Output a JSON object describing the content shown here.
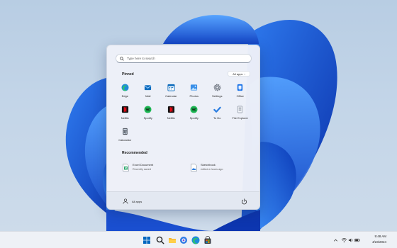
{
  "search": {
    "placeholder": "Type here to search"
  },
  "pinned": {
    "title": "Pinned",
    "all_apps_label": "All apps",
    "apps": [
      {
        "label": "Edge",
        "icon": "edge-icon"
      },
      {
        "label": "Mail",
        "icon": "mail-icon"
      },
      {
        "label": "Calendar",
        "icon": "calendar-icon"
      },
      {
        "label": "Photos",
        "icon": "photos-icon"
      },
      {
        "label": "Settings",
        "icon": "settings-icon"
      },
      {
        "label": "Office",
        "icon": "office-icon"
      },
      {
        "label": "Netflix",
        "icon": "netflix-icon"
      },
      {
        "label": "Spotify",
        "icon": "spotify-icon"
      },
      {
        "label": "Netflix",
        "icon": "netflix-icon"
      },
      {
        "label": "Spotify",
        "icon": "spotify-icon"
      },
      {
        "label": "To Do",
        "icon": "todo-icon"
      },
      {
        "label": "File Explorer",
        "icon": "file-explorer-icon"
      },
      {
        "label": "Calculator",
        "icon": "calculator-icon"
      }
    ]
  },
  "recommended": {
    "title": "Recommended",
    "items": [
      {
        "name": "Excel Document",
        "time": "Recently saved",
        "icon": "excel-document-icon"
      },
      {
        "name": "Sketchbook",
        "time": "edited a hours ago",
        "icon": "sketchbook-icon"
      }
    ]
  },
  "footer": {
    "user_name": "All apps"
  },
  "taskbar": {
    "icons": [
      "windows-start-icon",
      "search-icon",
      "file-explorer-icon",
      "chat-icon",
      "edge-icon",
      "store-icon"
    ],
    "time": "9:48 AM",
    "date": "4/23/2024"
  },
  "colors": {
    "accent": "#0067c0",
    "wallpaper_blue": "#1455d9",
    "netflix": "#e50914",
    "spotify": "#1db954"
  }
}
